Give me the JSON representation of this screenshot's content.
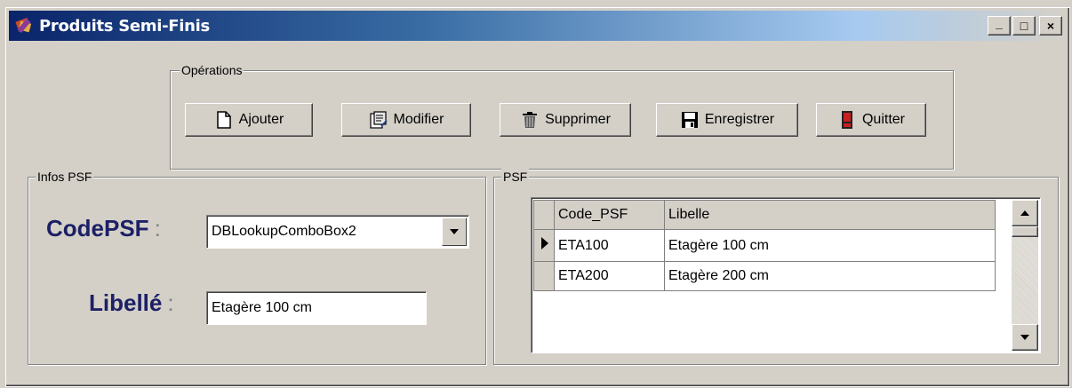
{
  "window": {
    "title": "Produits Semi-Finis",
    "minimize_label": "_",
    "maximize_label": "□",
    "close_label": "×"
  },
  "operations": {
    "label": "Opérations",
    "buttons": [
      {
        "label": "Ajouter",
        "icon": "new-document-icon"
      },
      {
        "label": "Modifier",
        "icon": "edit-document-icon"
      },
      {
        "label": "Supprimer",
        "icon": "trash-icon"
      },
      {
        "label": "Enregistrer",
        "icon": "floppy-disk-icon"
      },
      {
        "label": "Quitter",
        "icon": "exit-door-icon"
      }
    ]
  },
  "infos": {
    "label": "Infos PSF",
    "code_label": "CodePSF",
    "code_value": "DBLookupComboBox2",
    "libelle_label": "Libellé",
    "libelle_value": "Etagère 100 cm",
    "colon": ":"
  },
  "psf": {
    "label": "PSF",
    "columns": [
      "Code_PSF",
      "Libelle"
    ],
    "rows": [
      {
        "code": "ETA100",
        "libelle": "Etagère 100 cm",
        "current": true
      },
      {
        "code": "ETA200",
        "libelle": "Etagère 200 cm",
        "current": false
      }
    ]
  }
}
